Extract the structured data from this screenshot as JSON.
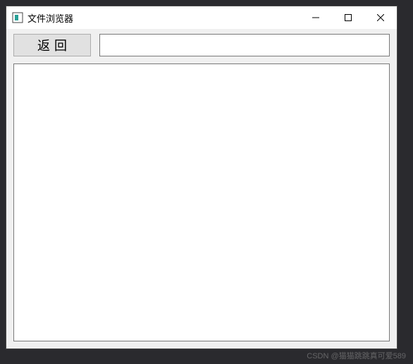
{
  "window": {
    "title": "文件浏览器"
  },
  "toolbar": {
    "back_label": "返回",
    "path_value": ""
  },
  "content": {
    "items": []
  },
  "watermark": "CSDN @猫猫跳跳真可爱589"
}
